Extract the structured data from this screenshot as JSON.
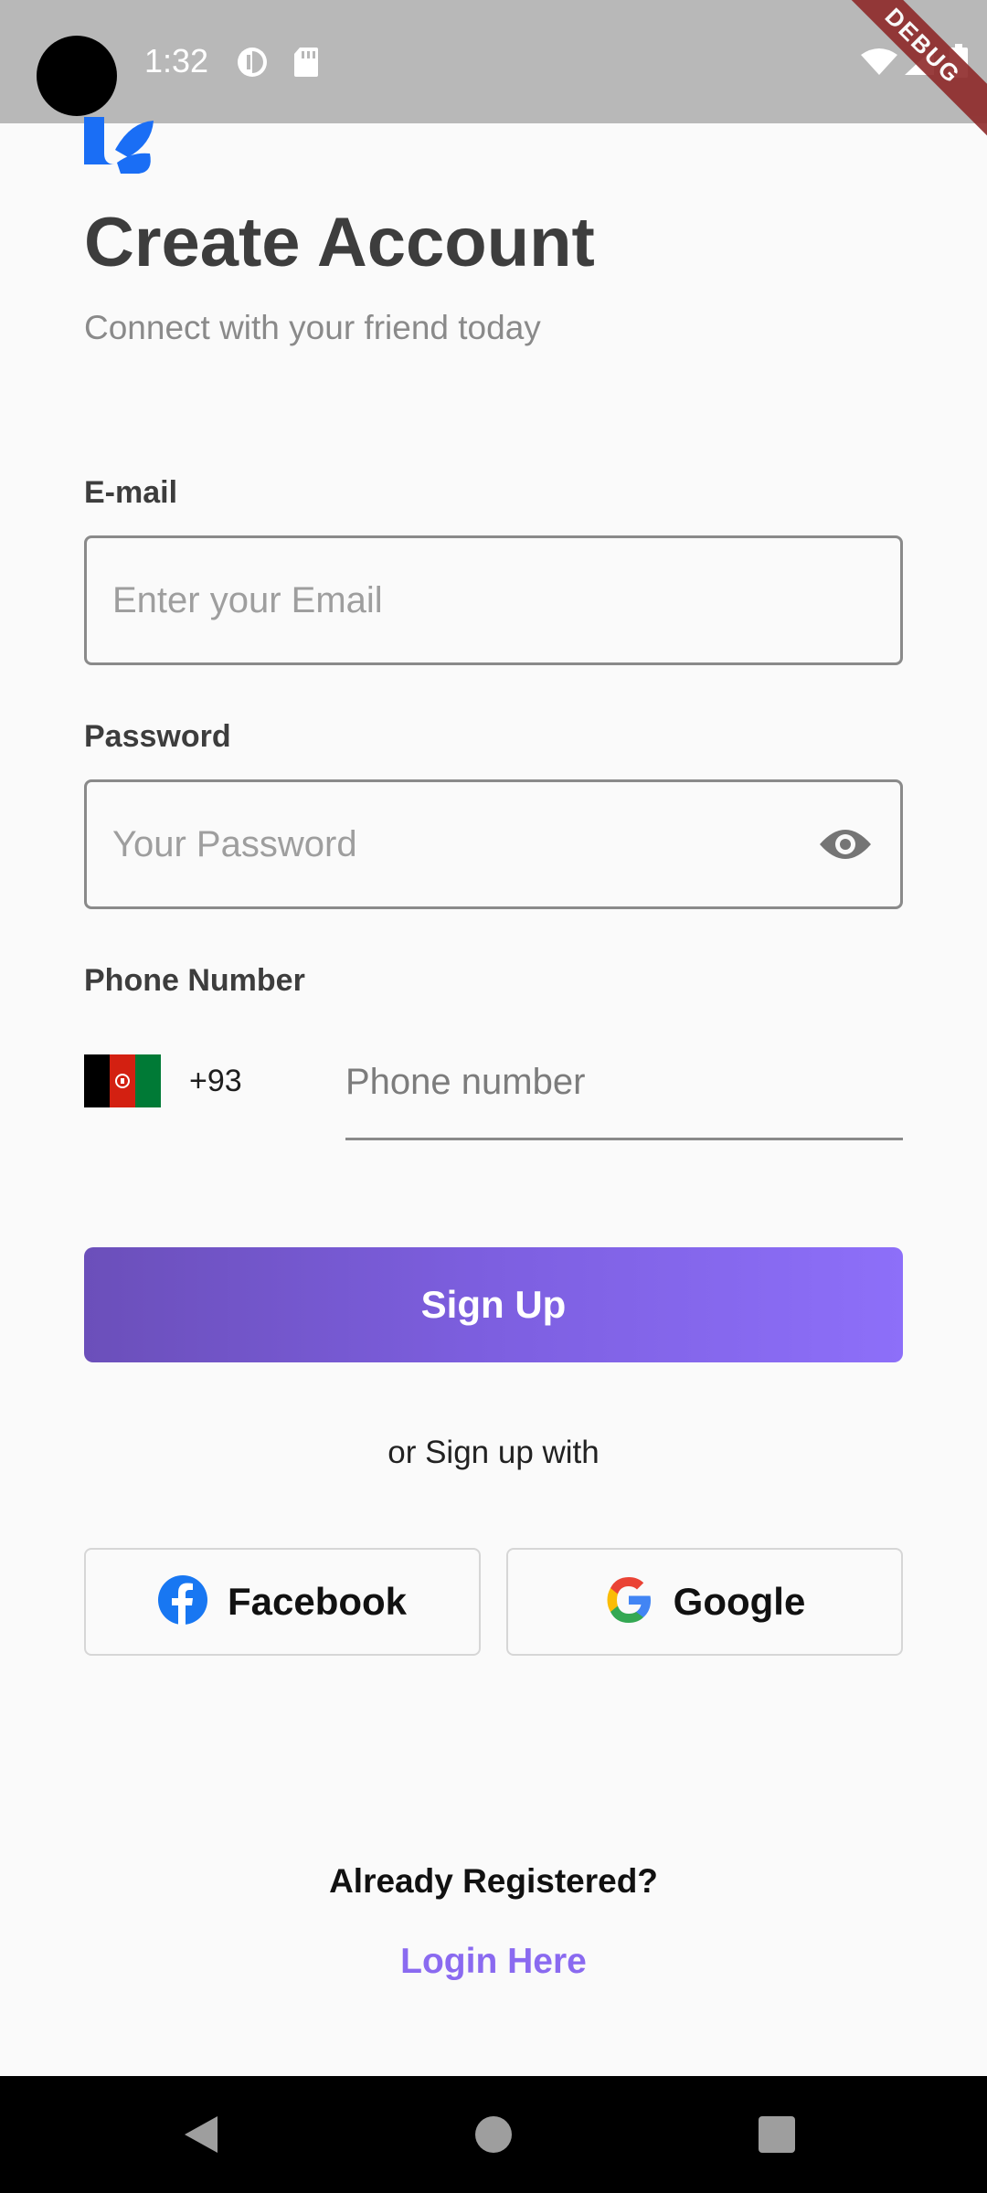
{
  "status_bar": {
    "time": "1:32",
    "debug_label": "DEBUG"
  },
  "header": {
    "title": "Create Account",
    "subtitle": "Connect with your friend today"
  },
  "form": {
    "email": {
      "label": "E-mail",
      "placeholder": "Enter your Email"
    },
    "password": {
      "label": "Password",
      "placeholder": "Your Password",
      "toggle_icon": "eye-icon"
    },
    "phone": {
      "label": "Phone Number",
      "country_flag": "afghanistan-flag-icon",
      "dial_code": "+93",
      "placeholder": "Phone number"
    },
    "submit_label": "Sign Up"
  },
  "social": {
    "divider_text": "or Sign up with",
    "facebook_label": "Facebook",
    "google_label": "Google"
  },
  "footer": {
    "already_text": "Already Registered?",
    "login_link": "Login Here"
  },
  "colors": {
    "accent": "#8a6af0",
    "button_gradient_start": "#6b4fba",
    "button_gradient_end": "#8d6ff9",
    "facebook_blue": "#1877f2"
  }
}
